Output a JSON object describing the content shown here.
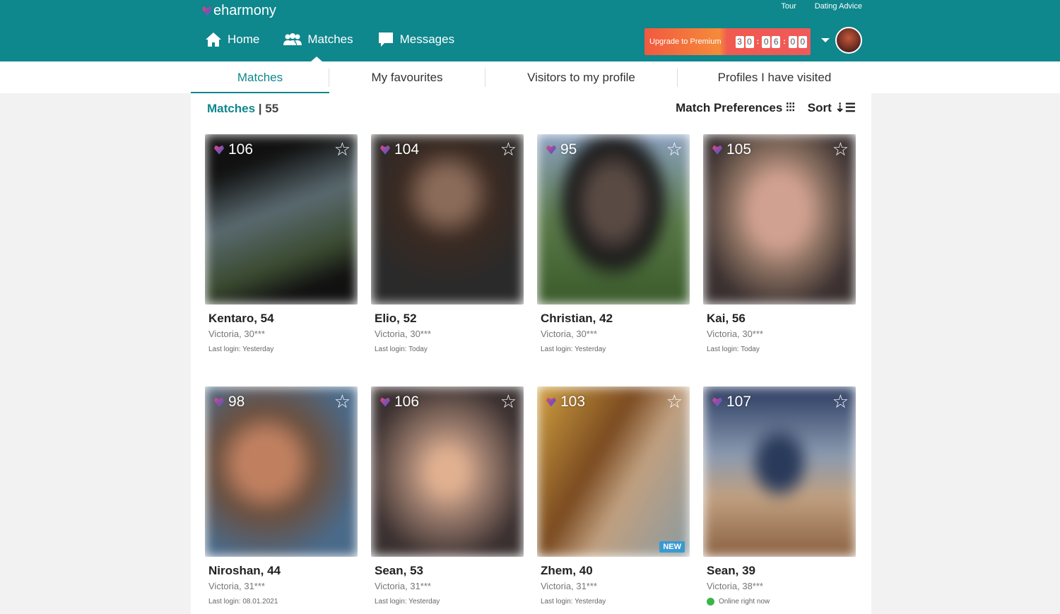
{
  "header": {
    "logo": "eharmony",
    "top_links": [
      "Tour",
      "Dating Advice"
    ],
    "nav": [
      {
        "label": "Home",
        "icon": "home-icon"
      },
      {
        "label": "Matches",
        "icon": "users-icon"
      },
      {
        "label": "Messages",
        "icon": "chat-icon"
      }
    ],
    "upgrade": "Upgrade to Premium",
    "timer": [
      "3",
      "0",
      "0",
      "6",
      "0",
      "0"
    ]
  },
  "tabs": [
    "Matches",
    "My favourites",
    "Visitors to my profile",
    "Profiles I have visited"
  ],
  "summary": {
    "label": "Matches",
    "count": "| 55",
    "preferences": "Match Preferences",
    "sort": "Sort"
  },
  "colors": {
    "brand": "#0e878d",
    "upgrade": "#f2593f"
  },
  "cards": [
    {
      "score": "106",
      "name": "Kentaro, 54",
      "location": "Victoria, 30***",
      "login": "Last login: Yesterday",
      "bg": "linear-gradient(160deg,#111 20%,#5a6a70 45%,#3a4a30 70%,#111 85%)"
    },
    {
      "score": "104",
      "name": "Elio, 52",
      "location": "Victoria, 30***",
      "login": "Last login: Today",
      "bg": "radial-gradient(circle at 50% 35%,#8a6a58 15%,#3a2a22 35%,#2a2a2a 70%),linear-gradient(#ccc,#333)"
    },
    {
      "score": "95",
      "name": "Christian, 42",
      "location": "Victoria, 30***",
      "login": "Last login: Yesterday",
      "bg": "radial-gradient(ellipse at 50% 40%,#5a4a44 20%,#1a1a1a 40%,transparent 55%),linear-gradient(#8aa0c0,#5a7a4a 50%,#3a5a2a)"
    },
    {
      "score": "105",
      "name": "Kai, 56",
      "location": "Victoria, 30***",
      "login": "Last login: Today",
      "bg": "radial-gradient(ellipse at 50% 45%,#d0a090 25%,#8a7060 45%,#3a3030 75%)"
    },
    {
      "score": "98",
      "name": "Niroshan, 44",
      "location": "Victoria, 31***",
      "login": "Last login: 08.01.2021",
      "bg": "radial-gradient(ellipse at 40% 45%,#c08060 20%,#6a5040 40%,#4a6a8a 75%)"
    },
    {
      "score": "106",
      "name": "Sean, 53",
      "location": "Victoria, 31***",
      "login": "Last login: Yesterday",
      "bg": "radial-gradient(ellipse at 50% 50%,#e0b090 15%,#a08070 35%,#3a3030 75%)"
    },
    {
      "score": "103",
      "name": "Zhem, 40",
      "location": "Victoria, 31***",
      "login": "Last login: Yesterday",
      "bg": "linear-gradient(120deg,#d0a040,#7a4a20 40%,#c0a080 60%,#8a9aa0)",
      "badge": "NEW"
    },
    {
      "score": "107",
      "name": "Sean, 39",
      "location": "Victoria, 38***",
      "login": "Online right now",
      "online": true,
      "bg": "radial-gradient(ellipse at 50% 45%,#2a3a5a 15%,transparent 30%),linear-gradient(#2a3a60,#8a9ab0 40%,#c0a080 65%,#8a6040)"
    }
  ]
}
